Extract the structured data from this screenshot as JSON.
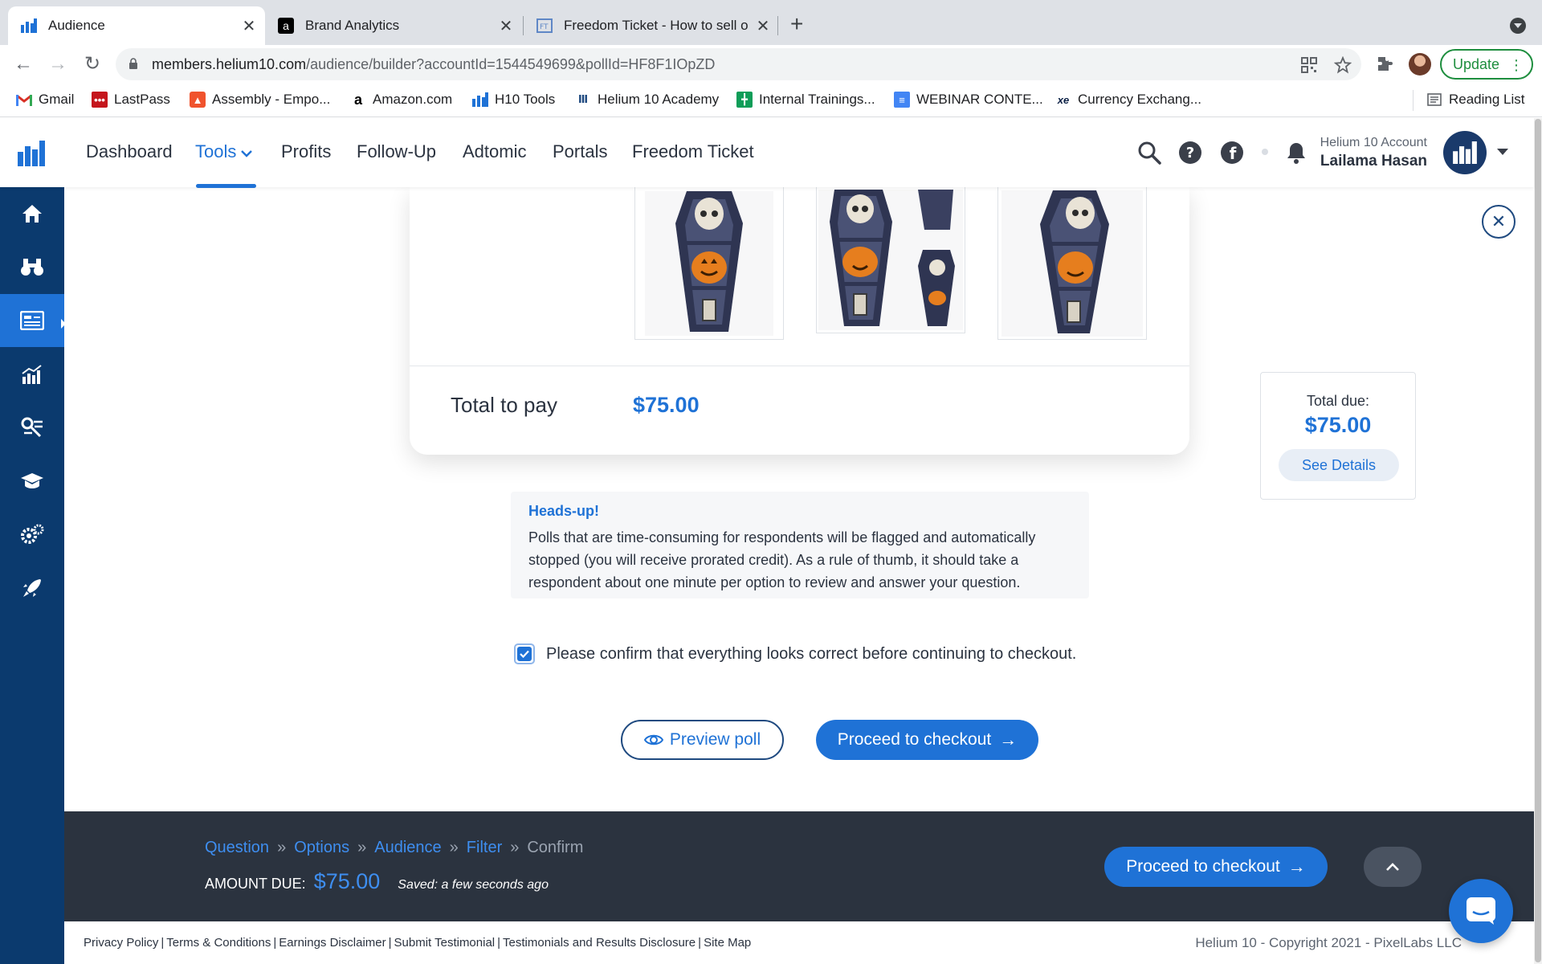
{
  "browser": {
    "tabs": [
      {
        "title": "Audience",
        "icon": "helium10-icon"
      },
      {
        "title": "Brand Analytics",
        "icon": "amazon-icon"
      },
      {
        "title": "Freedom Ticket - How to sell o",
        "icon": "freedom-ticket-icon"
      }
    ],
    "url_host": "members.helium10.com",
    "url_path": "/audience/builder?accountId=1544549699&pollId=HF8F1IOpZD",
    "update_label": "Update",
    "bookmarks": [
      {
        "label": "Gmail",
        "icon": "gmail-icon"
      },
      {
        "label": "LastPass",
        "icon": "lastpass-icon"
      },
      {
        "label": "Assembly - Empo...",
        "icon": "assembly-icon"
      },
      {
        "label": "Amazon.com",
        "icon": "amazon-icon"
      },
      {
        "label": "H10 Tools",
        "icon": "helium10-icon"
      },
      {
        "label": "Helium 10 Academy",
        "icon": "academy-icon"
      },
      {
        "label": "Internal Trainings...",
        "icon": "sheets-icon"
      },
      {
        "label": "WEBINAR CONTE...",
        "icon": "docs-icon"
      },
      {
        "label": "Currency Exchang...",
        "icon": "xe-icon"
      }
    ],
    "reading_list": "Reading List"
  },
  "nav": {
    "items": [
      "Dashboard",
      "Tools",
      "Profits",
      "Follow-Up",
      "Adtomic",
      "Portals",
      "Freedom Ticket"
    ],
    "active": "Tools",
    "account_label": "Helium 10 Account",
    "account_name": "Lailama Hasan"
  },
  "sidebar": {
    "items": [
      "home-icon",
      "binoculars-icon",
      "audience-icon",
      "chart-icon",
      "keyword-icon",
      "academy-icon",
      "settings-icon",
      "rocket-icon"
    ],
    "active_index": 2
  },
  "card": {
    "total_label": "Total to pay",
    "total_value": "$75.00"
  },
  "summary": {
    "label": "Total due:",
    "amount": "$75.00",
    "see_details": "See Details"
  },
  "headsup": {
    "title": "Heads-up!",
    "body": "Polls that are time-consuming for respondents will be flagged and automatically stopped (you will receive prorated credit). As a rule of thumb, it should take a respondent about one minute per option to review and answer your question."
  },
  "confirm": {
    "checked": true,
    "text": "Please confirm that everything looks correct before continuing to checkout."
  },
  "actions": {
    "preview": "Preview poll",
    "proceed": "Proceed to checkout"
  },
  "stepbar": {
    "steps": [
      "Question",
      "Options",
      "Audience",
      "Filter",
      "Confirm"
    ],
    "current": "Confirm",
    "amount_label": "AMOUNT DUE:",
    "amount_value": "$75.00",
    "saved": "Saved: a few seconds ago",
    "proceed": "Proceed to checkout"
  },
  "footer": {
    "links": [
      "Privacy Policy",
      "Terms & Conditions",
      "Earnings Disclaimer",
      "Submit Testimonial",
      "Testimonials and Results Disclosure",
      "Site Map"
    ],
    "copyright": "Helium 10 - Copyright 2021 - PixelLabs LLC"
  },
  "colors": {
    "accent": "#1f72d6",
    "sidebar": "#0b3a6e",
    "stepbar": "#2b333f"
  }
}
